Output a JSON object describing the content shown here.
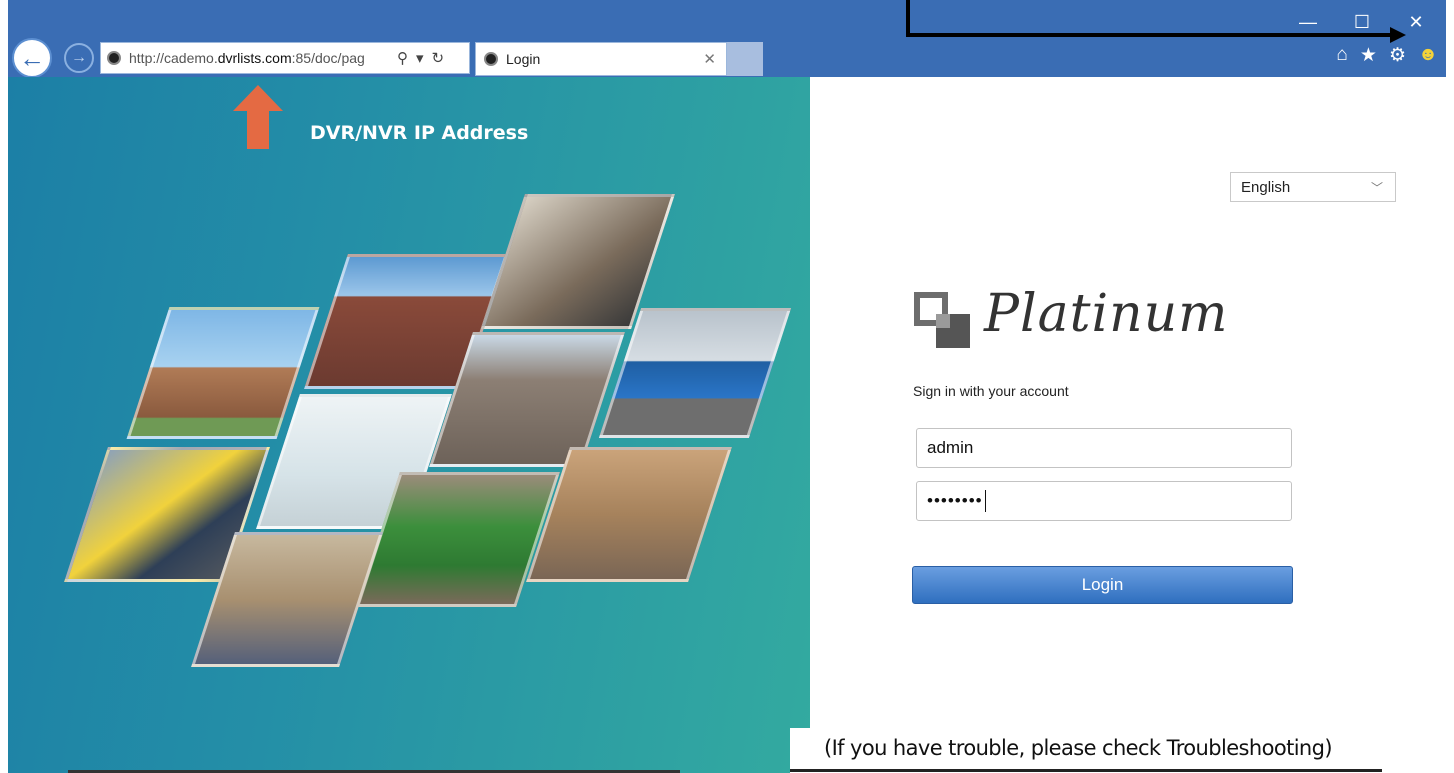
{
  "browser": {
    "address_prefix": "http://cademo.",
    "address_domain": "dvrlists.com",
    "address_suffix": ":85/doc/pag",
    "tab_title": "Login",
    "tab_close": "✕",
    "window_controls": {
      "minimize": "—",
      "maximize": "☐",
      "close": "✕"
    },
    "icons": [
      "home-icon",
      "star-icon",
      "gear-icon",
      "smiley-icon"
    ]
  },
  "annotation": {
    "ip_label": "DVR/NVR IP Address",
    "trouble_note": "(If you have trouble, please check Troubleshooting)"
  },
  "login": {
    "language": "English",
    "brand": "Platinum",
    "signin_text": "Sign in with your account",
    "username": "admin",
    "password_mask": "••••••••",
    "button_label": "Login"
  },
  "colors": {
    "chrome": "#3a6db4",
    "panel_from": "#1c7fa6",
    "panel_to": "#33aaa0",
    "arrow": "#e46a43",
    "button": "#3b7bcf"
  }
}
